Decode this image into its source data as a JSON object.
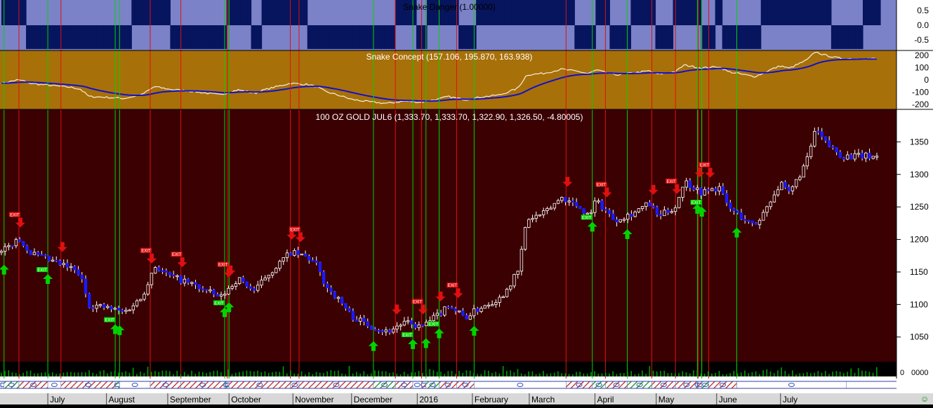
{
  "panels": {
    "danger": {
      "title": "Snake Danger (1.00000)",
      "ticks": [
        "0.5",
        "0.0",
        "-0.5"
      ],
      "ylim": [
        -0.85,
        0.85
      ]
    },
    "concept": {
      "title": "Snake Concept (157.106, 195.870, 163.938)",
      "ticks": [
        "200",
        "100",
        "0",
        "-100",
        "-200"
      ],
      "ylim": [
        -240,
        240
      ]
    },
    "price": {
      "title": "100 OZ GOLD JUL6 (1,333.70, 1,333.70, 1,322.90, 1,326.50, -4.80005)",
      "ticks": [
        "1350",
        "1300",
        "1250",
        "1200",
        "1150",
        "1100",
        "1050"
      ],
      "ylim": [
        1012,
        1400
      ]
    },
    "volume": {
      "tick_left": "0",
      "tick_right": "0000"
    }
  },
  "months": [
    {
      "label": "July",
      "pos": 0.053
    },
    {
      "label": "August",
      "pos": 0.12
    },
    {
      "label": "September",
      "pos": 0.19
    },
    {
      "label": "October",
      "pos": 0.26
    },
    {
      "label": "November",
      "pos": 0.333
    },
    {
      "label": "December",
      "pos": 0.4
    },
    {
      "label": "2016",
      "pos": 0.475
    },
    {
      "label": "February",
      "pos": 0.538
    },
    {
      "label": "March",
      "pos": 0.603
    },
    {
      "label": "April",
      "pos": 0.678
    },
    {
      "label": "May",
      "pos": 0.748
    },
    {
      "label": "June",
      "pos": 0.817
    },
    {
      "label": "July",
      "pos": 0.89
    }
  ],
  "smiley": "☺",
  "signal_label": "EXIT",
  "colors": {
    "danger_bg": "#7b82c8",
    "danger_bar": "#07155e",
    "concept_bg": "#a87008",
    "price_bg": "#3a0002",
    "sell": "#e01010",
    "buy": "#00d400",
    "trend_line": "#1010d0"
  },
  "chart_data": {
    "type": "candlestick",
    "title": "100 OZ GOLD JUL6",
    "x_range": [
      "July 2015",
      "July 2016"
    ],
    "ylim": [
      1012,
      1400
    ],
    "ohlc_last": {
      "open": 1333.7,
      "high": 1333.7,
      "low": 1322.9,
      "close": 1326.5,
      "change": -4.80005
    },
    "snake_concept_last": [
      157.106,
      195.87,
      163.938
    ],
    "snake_danger_last": 1.0,
    "close_path": {
      "x": [
        0,
        0.008,
        0.018,
        0.025,
        0.03,
        0.04,
        0.06,
        0.08,
        0.09,
        0.1,
        0.12,
        0.14,
        0.16,
        0.175,
        0.19,
        0.22,
        0.25,
        0.27,
        0.29,
        0.3,
        0.33,
        0.35,
        0.36,
        0.37,
        0.39,
        0.4,
        0.42,
        0.44,
        0.46,
        0.48,
        0.5,
        0.51,
        0.53,
        0.55,
        0.57,
        0.59,
        0.6,
        0.62,
        0.64,
        0.66,
        0.67,
        0.68,
        0.7,
        0.72,
        0.74,
        0.75,
        0.77,
        0.78,
        0.8,
        0.82,
        0.83,
        0.84,
        0.86,
        0.87,
        0.88,
        0.89,
        0.9,
        0.92,
        0.93,
        0.94,
        0.96
      ],
      "y": [
        1180,
        1188,
        1200,
        1195,
        1183,
        1175,
        1165,
        1155,
        1145,
        1100,
        1095,
        1088,
        1110,
        1160,
        1145,
        1130,
        1110,
        1140,
        1120,
        1140,
        1180,
        1172,
        1160,
        1130,
        1100,
        1082,
        1068,
        1058,
        1072,
        1065,
        1085,
        1100,
        1080,
        1098,
        1110,
        1150,
        1230,
        1240,
        1265,
        1250,
        1238,
        1260,
        1230,
        1240,
        1255,
        1235,
        1250,
        1290,
        1272,
        1280,
        1250,
        1240,
        1220,
        1240,
        1265,
        1285,
        1270,
        1320,
        1370,
        1350,
        1328
      ]
    },
    "sell_signals": [
      0.02,
      0.068,
      0.17,
      0.17,
      0.205,
      0.26,
      0.258,
      0.33,
      0.34,
      0.45,
      0.48,
      0.5,
      0.52,
      0.645,
      0.69,
      0.743,
      0.77,
      0.796,
      0.808
    ],
    "buy_signals": [
      0.003,
      0.053,
      0.135,
      0.13,
      0.26,
      0.255,
      0.425,
      0.47,
      0.485,
      0.5,
      0.54,
      0.675,
      0.715,
      0.8,
      0.795,
      0.8,
      0.84
    ]
  }
}
